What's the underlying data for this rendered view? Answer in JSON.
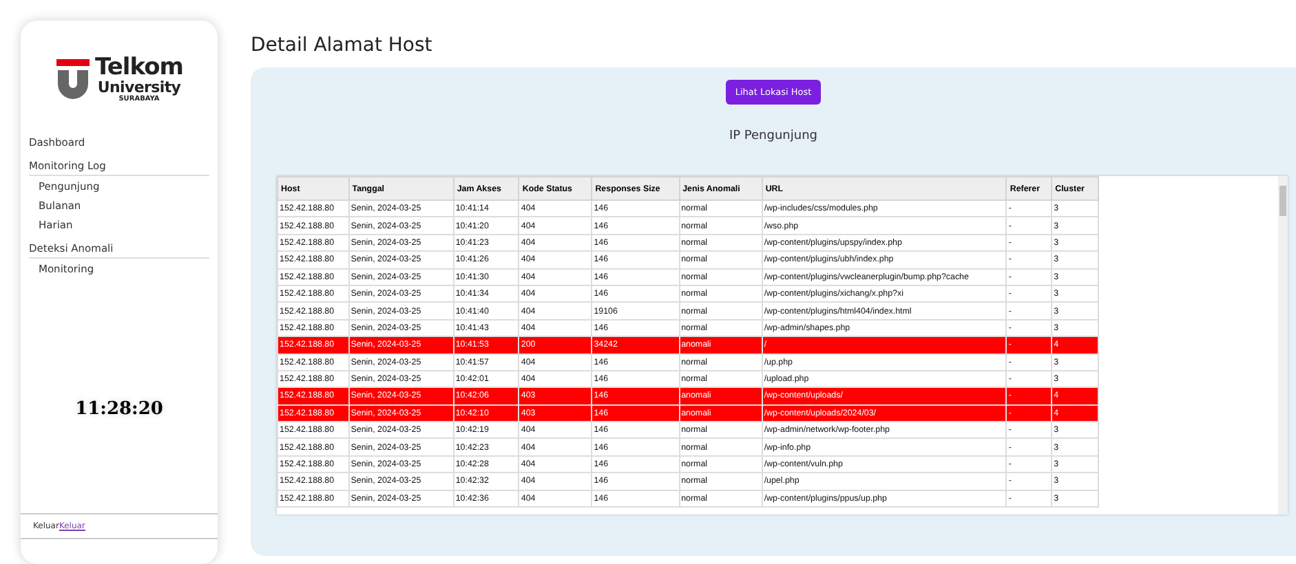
{
  "sidebar": {
    "logo": {
      "name": "Telkom",
      "line2": "University",
      "line3": "SURABAYA"
    },
    "menu": [
      {
        "label": "Dashboard"
      },
      {
        "label": "Monitoring Log",
        "children": [
          {
            "label": "Pengunjung"
          },
          {
            "label": "Bulanan"
          },
          {
            "label": "Harian"
          }
        ]
      },
      {
        "label": "Deteksi Anomali",
        "children": [
          {
            "label": "Monitoring"
          }
        ]
      }
    ],
    "clock": "11:28:20",
    "logout": {
      "label": "Keluar",
      "link": "Keluar"
    }
  },
  "page": {
    "title": "Detail Alamat Host",
    "button": "Lihat Lokasi Host",
    "subtitle": "IP Pengunjung"
  },
  "table": {
    "columns": [
      "Host",
      "Tanggal",
      "Jam Akses",
      "Kode Status",
      "Responses Size",
      "Jenis Anomali",
      "URL",
      "Referer",
      "Cluster"
    ],
    "rows": [
      {
        "flagged": false,
        "cells": [
          "152.42.188.80",
          "Senin, 2024-03-25",
          "10:41:14",
          "404",
          "146",
          "normal",
          "/wp-includes/css/modules.php",
          "-",
          "3"
        ]
      },
      {
        "flagged": false,
        "cells": [
          "152.42.188.80",
          "Senin, 2024-03-25",
          "10:41:20",
          "404",
          "146",
          "normal",
          "/wso.php",
          "-",
          "3"
        ]
      },
      {
        "flagged": false,
        "cells": [
          "152.42.188.80",
          "Senin, 2024-03-25",
          "10:41:23",
          "404",
          "146",
          "normal",
          "/wp-content/plugins/upspy/index.php",
          "-",
          "3"
        ]
      },
      {
        "flagged": false,
        "cells": [
          "152.42.188.80",
          "Senin, 2024-03-25",
          "10:41:26",
          "404",
          "146",
          "normal",
          "/wp-content/plugins/ubh/index.php",
          "-",
          "3"
        ]
      },
      {
        "flagged": false,
        "cells": [
          "152.42.188.80",
          "Senin, 2024-03-25",
          "10:41:30",
          "404",
          "146",
          "normal",
          "/wp-content/plugins/vwcleanerplugin/bump.php?cache",
          "-",
          "3"
        ]
      },
      {
        "flagged": false,
        "cells": [
          "152.42.188.80",
          "Senin, 2024-03-25",
          "10:41:34",
          "404",
          "146",
          "normal",
          "/wp-content/plugins/xichang/x.php?xi",
          "-",
          "3"
        ]
      },
      {
        "flagged": false,
        "cells": [
          "152.42.188.80",
          "Senin, 2024-03-25",
          "10:41:40",
          "404",
          "19106",
          "normal",
          "/wp-content/plugins/html404/index.html",
          "-",
          "3"
        ]
      },
      {
        "flagged": false,
        "cells": [
          "152.42.188.80",
          "Senin, 2024-03-25",
          "10:41:43",
          "404",
          "146",
          "normal",
          "/wp-admin/shapes.php",
          "-",
          "3"
        ]
      },
      {
        "flagged": true,
        "cells": [
          "152.42.188.80",
          "Senin, 2024-03-25",
          "10:41:53",
          "200",
          "34242",
          "anomali",
          "/",
          "-",
          "4"
        ]
      },
      {
        "flagged": false,
        "cells": [
          "152.42.188.80",
          "Senin, 2024-03-25",
          "10:41:57",
          "404",
          "146",
          "normal",
          "/up.php",
          "-",
          "3"
        ]
      },
      {
        "flagged": false,
        "cells": [
          "152.42.188.80",
          "Senin, 2024-03-25",
          "10:42:01",
          "404",
          "146",
          "normal",
          "/upload.php",
          "-",
          "3"
        ]
      },
      {
        "flagged": true,
        "cells": [
          "152.42.188.80",
          "Senin, 2024-03-25",
          "10:42:06",
          "403",
          "146",
          "anomali",
          "/wp-content/uploads/",
          "-",
          "4"
        ]
      },
      {
        "flagged": true,
        "cells": [
          "152.42.188.80",
          "Senin, 2024-03-25",
          "10:42:10",
          "403",
          "146",
          "anomali",
          "/wp-content/uploads/2024/03/",
          "-",
          "4"
        ]
      },
      {
        "flagged": false,
        "cells": [
          "152.42.188.80",
          "Senin, 2024-03-25",
          "10:42:19",
          "404",
          "146",
          "normal",
          "/wp-admin/network/wp-footer.php",
          "-",
          "3"
        ]
      },
      {
        "flagged": false,
        "cells": [
          "152.42.188.80",
          "Senin, 2024-03-25",
          "10:42:23",
          "404",
          "146",
          "normal",
          "/wp-info.php",
          "-",
          "3"
        ]
      },
      {
        "flagged": false,
        "cells": [
          "152.42.188.80",
          "Senin, 2024-03-25",
          "10:42:28",
          "404",
          "146",
          "normal",
          "/wp-content/vuln.php",
          "-",
          "3"
        ]
      },
      {
        "flagged": false,
        "cells": [
          "152.42.188.80",
          "Senin, 2024-03-25",
          "10:42:32",
          "404",
          "146",
          "normal",
          "/upel.php",
          "-",
          "3"
        ]
      },
      {
        "flagged": false,
        "cells": [
          "152.42.188.80",
          "Senin, 2024-03-25",
          "10:42:36",
          "404",
          "146",
          "normal",
          "/wp-content/plugins/ppus/up.php",
          "-",
          "3"
        ]
      }
    ]
  }
}
